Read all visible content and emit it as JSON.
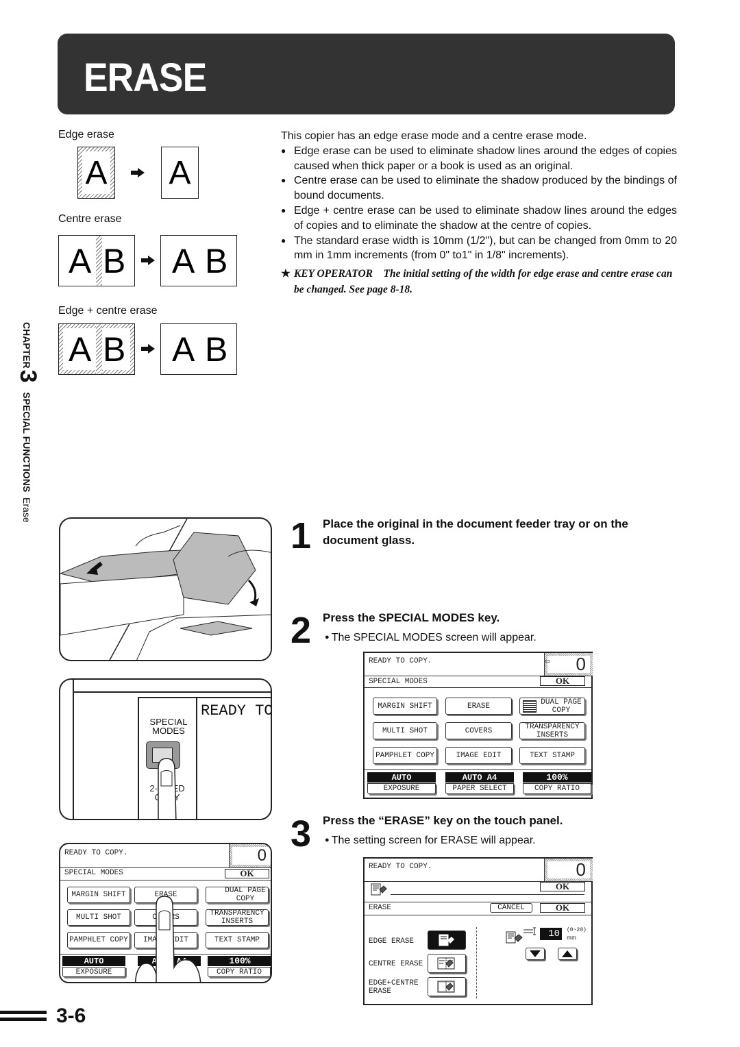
{
  "title": "ERASE",
  "diagrams": {
    "edge_erase_label": "Edge erase",
    "centre_erase_label": "Centre erase",
    "edge_centre_erase_label": "Edge + centre erase",
    "letter_a": "A",
    "letter_b": "B"
  },
  "intro": {
    "lead": "This copier has an edge erase mode and a centre erase mode.",
    "bullets": [
      "Edge erase can be used to eliminate shadow lines around the edges of copies caused when thick paper or a book is used as an original.",
      "Centre erase can be used to eliminate the shadow produced by the bindings of bound documents.",
      "Edge + centre erase can be used to eliminate shadow lines around the edges of copies and to eliminate the shadow at the centre of copies.",
      "The standard erase width is 10mm (1/2\"), but can be changed from 0mm to 20 mm in 1mm increments (from 0\" to1\" in 1/8\" increments)."
    ],
    "key_operator_star": "★",
    "key_operator_label": "KEY OPERATOR",
    "key_operator_text": "The initial setting of the width for edge erase and centre erase can be changed. See page 8-18."
  },
  "side_tab": {
    "chapter_label": "CHAPTER",
    "chapter_number": "3",
    "section": "SPECIAL FUNCTIONS",
    "subsection": "Erase"
  },
  "steps": [
    {
      "number": "1",
      "title": "Place the original in the document feeder tray or on the document glass."
    },
    {
      "number": "2",
      "title": "Press the SPECIAL MODES key.",
      "note": "The SPECIAL MODES screen will appear."
    },
    {
      "number": "3",
      "title": "Press the “ERASE” key on the touch panel.",
      "note": "The setting screen for ERASE will appear."
    }
  ],
  "panel_illustration": {
    "ready_text": "READY TO C",
    "key_label_line1": "SPECIAL",
    "key_label_line2": "MODES",
    "partial_key_line1": "2-SIDED",
    "partial_key_line2": "COPY"
  },
  "special_modes_screen": {
    "status": "READY TO COPY.",
    "copy_count": "0",
    "header": "SPECIAL MODES",
    "ok_label": "OK",
    "buttons": [
      "MARGIN SHIFT",
      "ERASE",
      "DUAL PAGE COPY",
      "MULTI SHOT",
      "COVERS",
      "TRANSPARENCY INSERTS",
      "PAMPHLET COPY",
      "IMAGE EDIT",
      "TEXT STAMP"
    ],
    "status_bar": [
      {
        "value": "AUTO",
        "label": "EXPOSURE"
      },
      {
        "value": "AUTO A4",
        "label": "PAPER SELECT"
      },
      {
        "value": "100%",
        "label": "COPY RATIO"
      }
    ]
  },
  "erase_screen": {
    "status": "READY TO COPY.",
    "copy_count": "0",
    "ok_label": "OK",
    "header": "ERASE",
    "cancel_label": "CANCEL",
    "options": [
      {
        "label": "EDGE ERASE",
        "selected": true
      },
      {
        "label": "CENTRE ERASE",
        "selected": false
      },
      {
        "label": "EDGE+CENTRE ERASE",
        "selected": false
      }
    ],
    "width_value": "10",
    "width_range": "(0~20)",
    "width_unit": "mm"
  },
  "page_number": "3-6"
}
